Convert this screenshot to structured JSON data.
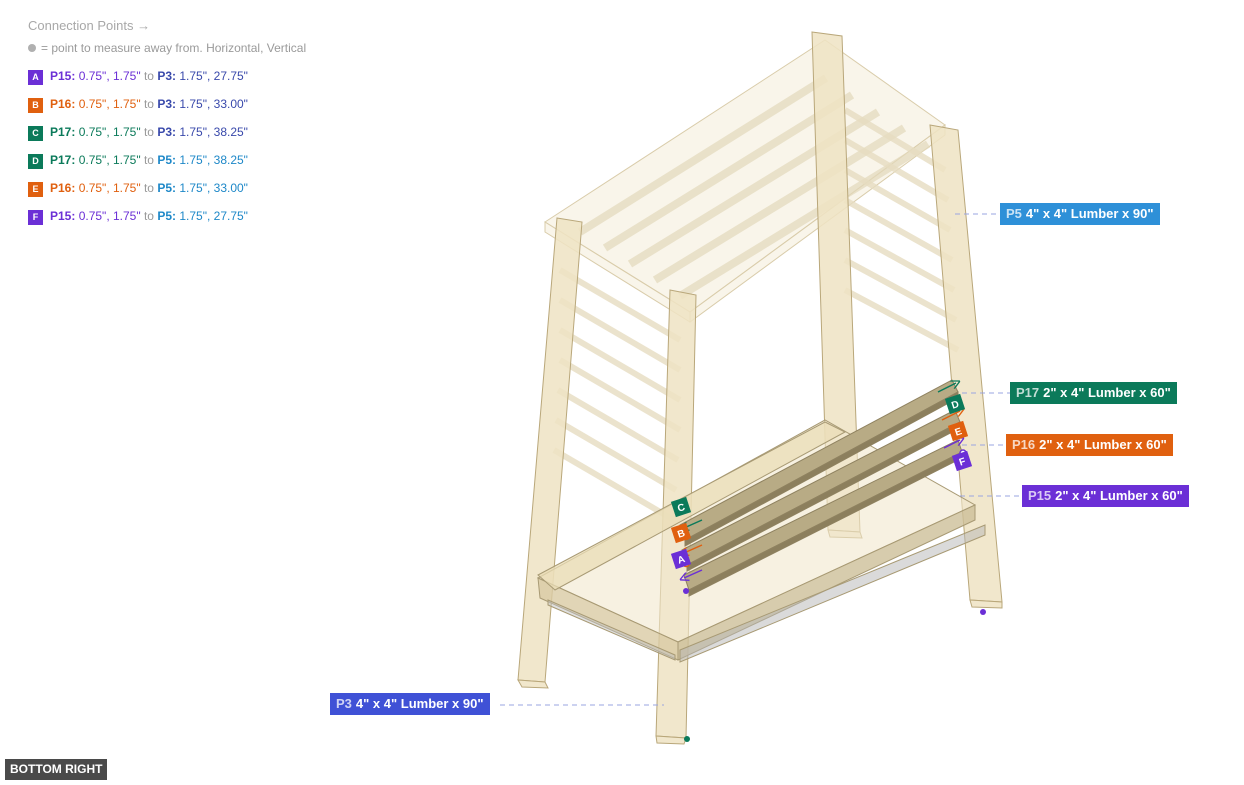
{
  "legend": {
    "title": "Connection Points →",
    "note": "= point to measure away from. Horizontal, Vertical",
    "items": [
      {
        "badge": "A",
        "color": "#6b2fd6",
        "from_id": "P15:",
        "from_val1": "0.75\",",
        "from_val2": "1.75\"",
        "to": "to",
        "to_id": "P3:",
        "to_val": "1.75\", 27.75\"",
        "to_color": "#3949ab"
      },
      {
        "badge": "B",
        "color": "#e0600f",
        "from_id": "P16:",
        "from_val1": "0.75\",",
        "from_val2": "1.75\"",
        "to": "to",
        "to_id": "P3:",
        "to_val": "1.75\", 33.00\"",
        "to_color": "#3949ab"
      },
      {
        "badge": "C",
        "color": "#0b7a5a",
        "from_id": "P17:",
        "from_val1": "0.75\",",
        "from_val2": "1.75\"",
        "to": "to",
        "to_id": "P3:",
        "to_val": "1.75\", 38.25\"",
        "to_color": "#3949ab"
      },
      {
        "badge": "D",
        "color": "#0b7a5a",
        "from_id": "P17:",
        "from_val1": "0.75\",",
        "from_val2": "1.75\"",
        "to": "to",
        "to_id": "P5:",
        "to_val": "1.75\", 38.25\"",
        "to_color": "#1e88c8"
      },
      {
        "badge": "E",
        "color": "#e0600f",
        "from_id": "P16:",
        "from_val1": "0.75\",",
        "from_val2": "1.75\"",
        "to": "to",
        "to_id": "P5:",
        "to_val": "1.75\", 33.00\"",
        "to_color": "#1e88c8"
      },
      {
        "badge": "F",
        "color": "#6b2fd6",
        "from_id": "P15:",
        "from_val1": "0.75\",",
        "from_val2": "1.75\"",
        "to": "to",
        "to_id": "P5:",
        "to_val": "1.75\", 27.75\"",
        "to_color": "#1e88c8"
      }
    ]
  },
  "callouts": [
    {
      "id": "P5",
      "text": "4\" x 4\" Lumber x 90\"",
      "color": "#2e90d8"
    },
    {
      "id": "P17",
      "text": "2\" x 4\" Lumber  x 60\"",
      "color": "#0b7a5a"
    },
    {
      "id": "P16",
      "text": "2\" x 4\" Lumber  x 60\"",
      "color": "#e0600f"
    },
    {
      "id": "P15",
      "text": "2\" x 4\" Lumber  x 60\"",
      "color": "#6b2fd6"
    },
    {
      "id": "P3",
      "text": "4\" x 4\" Lumber x 90\"",
      "color": "#3f51d6"
    }
  ],
  "markers": [
    "A",
    "B",
    "C",
    "D",
    "E",
    "F"
  ],
  "view_label": "BOTTOM RIGHT"
}
